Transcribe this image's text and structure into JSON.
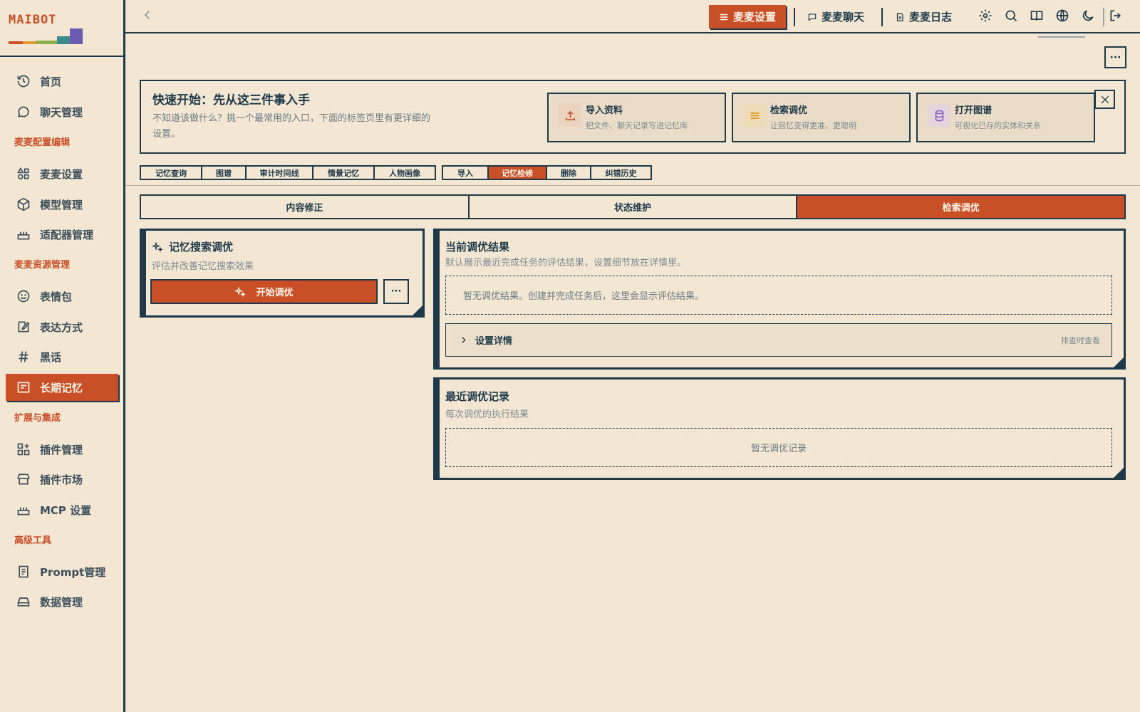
{
  "app": {
    "logo": "MAIBOT"
  },
  "sidebar": {
    "items": [
      {
        "label": "首页",
        "icon": "history-icon"
      },
      {
        "label": "聊天管理",
        "icon": "chat-icon"
      },
      {
        "label": "麦麦设置",
        "icon": "shapes-icon"
      },
      {
        "label": "模型管理",
        "icon": "box-icon"
      },
      {
        "label": "适配器管理",
        "icon": "router-icon"
      },
      {
        "label": "表情包",
        "icon": "smile-icon"
      },
      {
        "label": "表达方式",
        "icon": "edit-icon"
      },
      {
        "label": "黑话",
        "icon": "hash-icon"
      },
      {
        "label": "长期记忆",
        "icon": "memory-icon"
      },
      {
        "label": "插件管理",
        "icon": "plugin-icon"
      },
      {
        "label": "插件市场",
        "icon": "store-icon"
      },
      {
        "label": "MCP 设置",
        "icon": "router-icon"
      },
      {
        "label": "Prompt管理",
        "icon": "document-icon"
      },
      {
        "label": "数据管理",
        "icon": "drive-icon"
      }
    ],
    "sections": [
      "麦麦配置编辑",
      "麦麦资源管理",
      "扩展与集成",
      "高级工具"
    ]
  },
  "topbar": {
    "settings": "麦麦设置",
    "chat": "麦麦聊天",
    "log": "麦麦日志"
  },
  "banner": {
    "title": "快速开始：先从这三件事入手",
    "desc": "不知道该做什么？挑一个最常用的入口，下面的标签页里有更详细的设置。",
    "cards": [
      {
        "title": "导入资料",
        "desc": "把文件、聊天记录写进记忆库",
        "color": "#c94f27"
      },
      {
        "title": "检索调优",
        "desc": "让回忆变得更准、更聪明",
        "color": "#e09a2a"
      },
      {
        "title": "打开图谱",
        "desc": "可视化已存的实体和关系",
        "color": "#8b5cc4"
      }
    ]
  },
  "tabs": {
    "group1": [
      "记忆查询",
      "图谱",
      "审计时间线",
      "情景记忆",
      "人物画像"
    ],
    "group2": [
      "导入",
      "记忆检修",
      "删除",
      "纠错历史"
    ]
  },
  "segments": [
    "内容修正",
    "状态维护",
    "检索调优"
  ],
  "tune": {
    "title": "记忆搜索调优",
    "sub": "评估并改善记忆搜索效果",
    "start": "开始调优",
    "more": "···"
  },
  "result": {
    "title": "当前调优结果",
    "sub": "默认展示最近完成任务的评估结果，设置细节放在详情里。",
    "empty": "暂无调优结果。创建并完成任务后，这里会显示评估结果。",
    "details_label": "设置详情",
    "details_hint": "排查时查看"
  },
  "records": {
    "title": "最近调优记录",
    "sub": "每次调优的执行结果",
    "empty": "暂无调优记录"
  },
  "top_more": "···"
}
